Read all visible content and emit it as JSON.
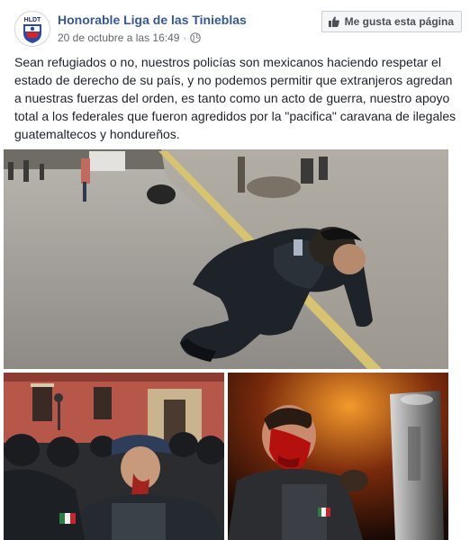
{
  "post": {
    "page_name": "Honorable Liga de las Tinieblas",
    "avatar_text": "HLDT",
    "timestamp": "20 de octubre a las 16:49",
    "separator": "·",
    "audience_icon": "globe-icon",
    "like_button_label": "Me gusta esta página",
    "like_icon": "thumbs-up-icon",
    "text": "Sean refugiados o no, nuestros policías son mexicanos haciendo respetar el estado de derecho de su país, y no podemos permitir que extranjeros agredan a nuestras fuerzas del orden, es tanto como un acto de guerra, nuestro apoyo total a los federales que fueron agredidos por la \"pacifica\" caravana de ilegales guatemaltecos y hondureños.",
    "photos": [
      {
        "name": "kneeling-officer-photo"
      },
      {
        "name": "bloodied-officer-crowd-photo"
      },
      {
        "name": "bloodied-officer-shield-photo"
      }
    ]
  },
  "colors": {
    "link": "#365899",
    "meta": "#616770",
    "text": "#1d2129",
    "button_bg": "#f5f6f7",
    "button_border": "#ccd0d5"
  }
}
